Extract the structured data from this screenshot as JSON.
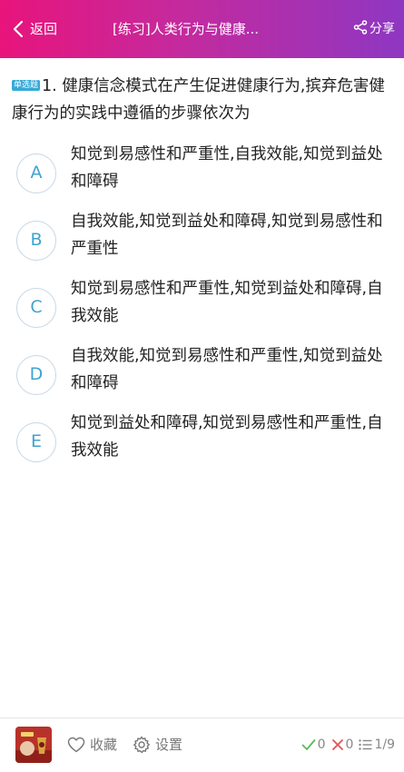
{
  "header": {
    "back_label": "返回",
    "title": "[练习]人类行为与健康...",
    "share_label": "分享"
  },
  "question": {
    "type_badge": "单选题",
    "number": "1.",
    "text": " 健康信念模式在产生促进健康行为,摈弃危害健康行为的实践中遵循的步骤依次为"
  },
  "options": [
    {
      "letter": "A",
      "text": "知觉到易感性和严重性,自我效能,知觉到益处和障碍"
    },
    {
      "letter": "B",
      "text": "自我效能,知觉到益处和障碍,知觉到易感性和严重性"
    },
    {
      "letter": "C",
      "text": "知觉到易感性和严重性,知觉到益处和障碍,自我效能"
    },
    {
      "letter": "D",
      "text": "自我效能,知觉到易感性和严重性,知觉到益处和障碍"
    },
    {
      "letter": "E",
      "text": "知觉到益处和障碍,知觉到易感性和严重性,自我效能"
    }
  ],
  "footer": {
    "favorite_label": "收藏",
    "settings_label": "设置",
    "correct_count": "0",
    "wrong_count": "0",
    "progress": "1/9"
  },
  "colors": {
    "header_gradient_start": "#e8147c",
    "header_gradient_end": "#8e37c2",
    "option_letter": "#3fa3cf",
    "option_border": "#c7d7e5",
    "badge": "#35a9d8",
    "correct": "#5cb85c",
    "wrong": "#e05555"
  },
  "icons": {
    "back": "chevron-left-icon",
    "share": "share-icon",
    "favorite": "heart-icon",
    "settings": "gear-icon",
    "correct": "check-icon",
    "wrong": "cross-icon",
    "progress": "list-icon"
  }
}
